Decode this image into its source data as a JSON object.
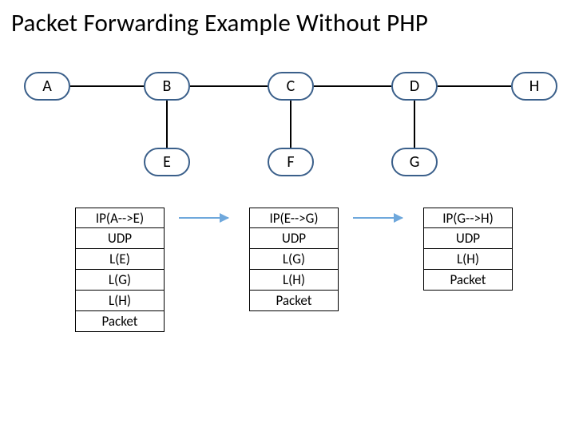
{
  "title": "Packet Forwarding Example Without PHP",
  "nodes": {
    "a": "A",
    "b": "B",
    "c": "C",
    "d": "D",
    "h": "H",
    "e": "E",
    "f": "F",
    "g": "G"
  },
  "stacks": {
    "s1": [
      "IP(A-->E)",
      "UDP",
      "L(E)",
      "L(G)",
      "L(H)",
      "Packet"
    ],
    "s2": [
      "IP(E-->G)",
      "UDP",
      "L(G)",
      "L(H)",
      "Packet"
    ],
    "s3": [
      "IP(G-->H)",
      "UDP",
      "L(H)",
      "Packet"
    ]
  },
  "chart_data": {
    "type": "diagram",
    "title": "Packet Forwarding Example Without PHP",
    "nodes": [
      "A",
      "B",
      "C",
      "D",
      "H",
      "E",
      "F",
      "G"
    ],
    "edges": [
      [
        "A",
        "B"
      ],
      [
        "B",
        "C"
      ],
      [
        "C",
        "D"
      ],
      [
        "D",
        "H"
      ],
      [
        "B",
        "E"
      ],
      [
        "C",
        "F"
      ],
      [
        "D",
        "G"
      ]
    ],
    "packet_stacks": [
      {
        "from": "A",
        "to": "E",
        "layers": [
          "IP(A-->E)",
          "UDP",
          "L(E)",
          "L(G)",
          "L(H)",
          "Packet"
        ]
      },
      {
        "from": "E",
        "to": "G",
        "layers": [
          "IP(E-->G)",
          "UDP",
          "L(G)",
          "L(H)",
          "Packet"
        ]
      },
      {
        "from": "G",
        "to": "H",
        "layers": [
          "IP(G-->H)",
          "UDP",
          "L(H)",
          "Packet"
        ]
      }
    ],
    "flow_arrows": [
      {
        "from_stack": 0,
        "to_stack": 1
      },
      {
        "from_stack": 1,
        "to_stack": 2
      }
    ]
  }
}
